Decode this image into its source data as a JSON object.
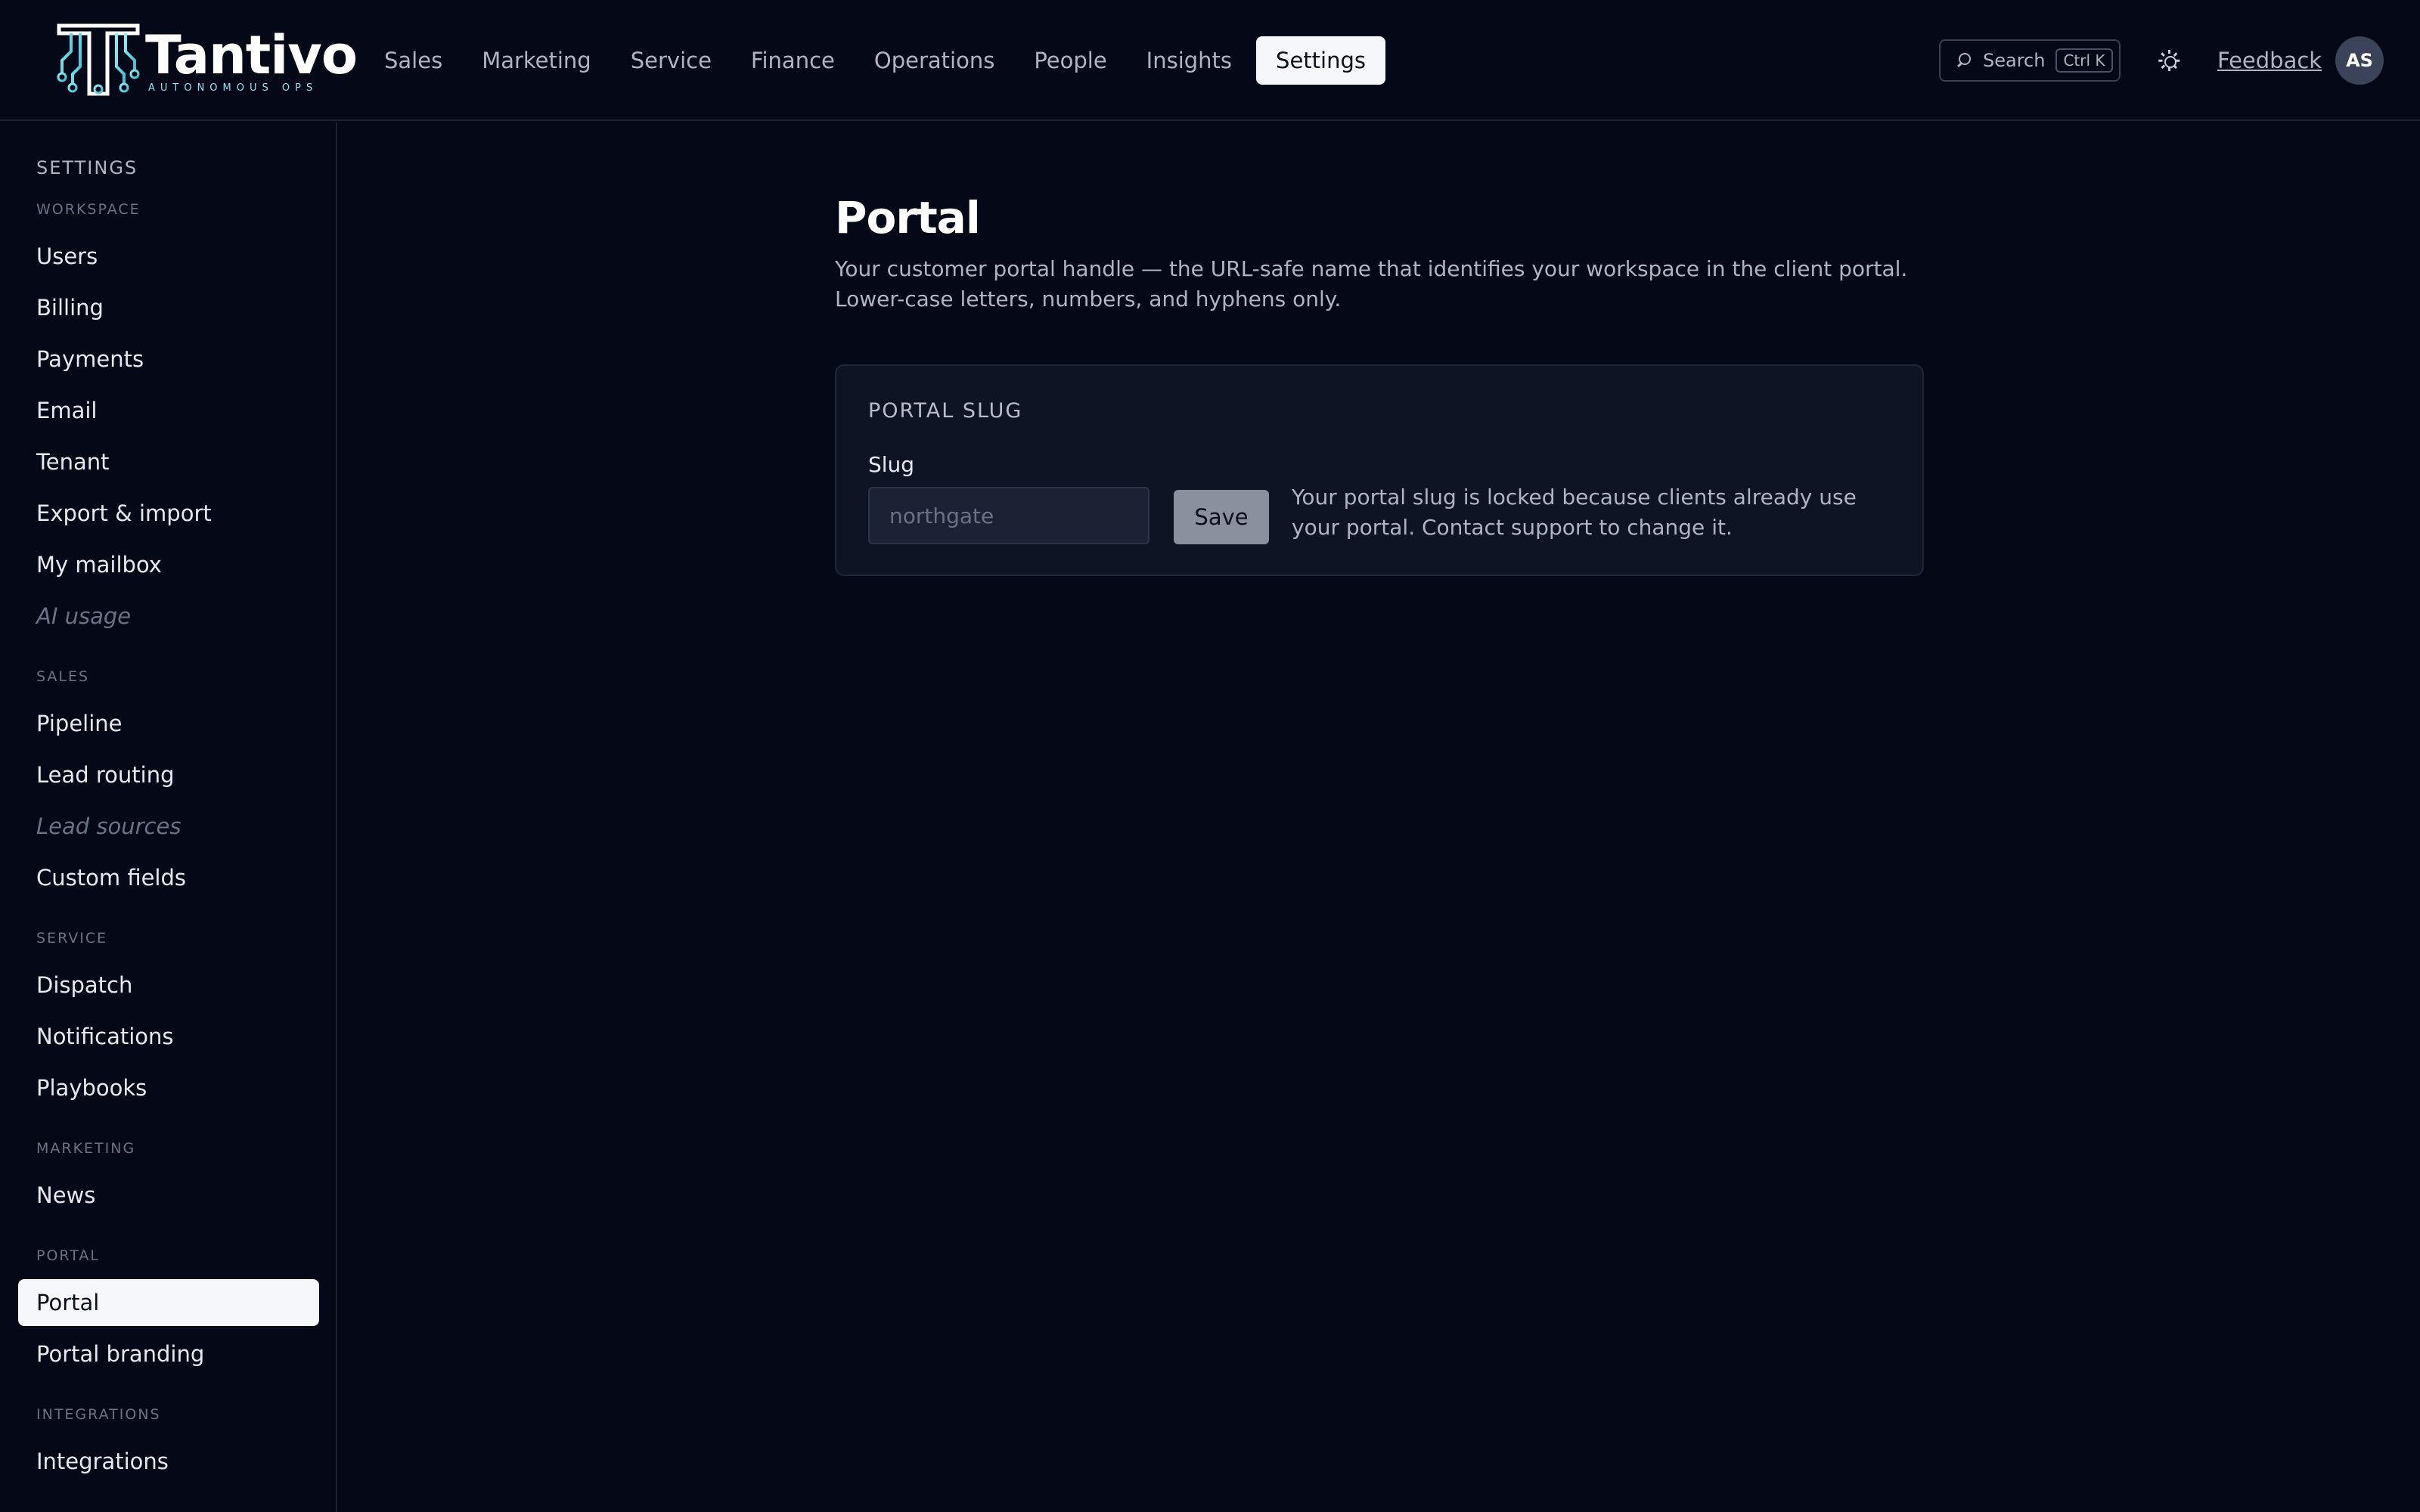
{
  "brand": {
    "name": "Tantivo",
    "tagline": "AUTONOMOUS OPS",
    "accent": "#5fd6e3"
  },
  "nav": {
    "items": [
      {
        "label": "Sales"
      },
      {
        "label": "Marketing"
      },
      {
        "label": "Service"
      },
      {
        "label": "Finance"
      },
      {
        "label": "Operations"
      },
      {
        "label": "People"
      },
      {
        "label": "Insights"
      },
      {
        "label": "Settings",
        "active": true
      }
    ]
  },
  "header": {
    "search_label": "Search",
    "search_shortcut": "Ctrl K",
    "theme_icon": "sun-icon",
    "feedback_label": "Feedback",
    "avatar_initials": "AS"
  },
  "sidebar": {
    "title": "SETTINGS",
    "sections": [
      {
        "label": "WORKSPACE",
        "items": [
          {
            "label": "Users"
          },
          {
            "label": "Billing"
          },
          {
            "label": "Payments"
          },
          {
            "label": "Email"
          },
          {
            "label": "Tenant"
          },
          {
            "label": "Export & import"
          },
          {
            "label": "My mailbox"
          },
          {
            "label": "AI usage",
            "disabled": true
          }
        ]
      },
      {
        "label": "SALES",
        "items": [
          {
            "label": "Pipeline"
          },
          {
            "label": "Lead routing"
          },
          {
            "label": "Lead sources",
            "disabled": true
          },
          {
            "label": "Custom fields"
          }
        ]
      },
      {
        "label": "SERVICE",
        "items": [
          {
            "label": "Dispatch"
          },
          {
            "label": "Notifications"
          },
          {
            "label": "Playbooks"
          }
        ]
      },
      {
        "label": "MARKETING",
        "items": [
          {
            "label": "News"
          }
        ]
      },
      {
        "label": "PORTAL",
        "items": [
          {
            "label": "Portal",
            "active": true
          },
          {
            "label": "Portal branding"
          }
        ]
      },
      {
        "label": "INTEGRATIONS",
        "items": [
          {
            "label": "Integrations"
          }
        ]
      }
    ]
  },
  "main": {
    "title": "Portal",
    "description": "Your customer portal handle — the URL-safe name that identifies your workspace in the client portal. Lower-case letters, numbers, and hyphens only.",
    "card": {
      "title": "PORTAL SLUG",
      "field_label": "Slug",
      "slug_value": "",
      "slug_placeholder": "northgate",
      "save_label": "Save",
      "lock_note": "Your portal slug is locked because clients already use your portal. Contact support to change it."
    }
  }
}
